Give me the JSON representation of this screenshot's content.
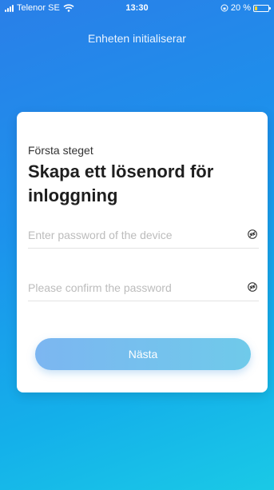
{
  "status_bar": {
    "carrier": "Telenor SE",
    "time": "13:30",
    "battery": "20 %",
    "battery_level": 0.2
  },
  "header": {
    "title": "Enheten initialiserar"
  },
  "card": {
    "step_label": "Första steget",
    "heading": "Skapa ett lösenord för inloggning",
    "password_field": {
      "placeholder": "Enter password of the device",
      "value": ""
    },
    "confirm_field": {
      "placeholder": "Please confirm the password",
      "value": ""
    },
    "next_button_label": "Nästa"
  },
  "colors": {
    "accent": "#1c92ec",
    "button_start": "#7cb6f1",
    "button_end": "#6fcaea"
  },
  "icons": [
    "signal-icon",
    "wifi-icon",
    "rotation-lock-icon",
    "battery-icon",
    "eye-icon"
  ]
}
